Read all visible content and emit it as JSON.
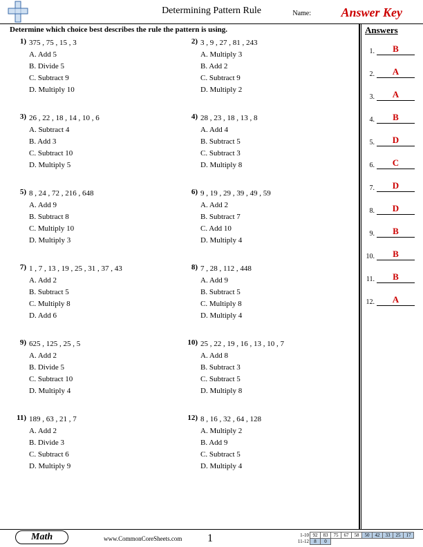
{
  "header": {
    "title": "Determining Pattern Rule",
    "name_label": "Name:",
    "answer_key": "Answer Key"
  },
  "instructions": "Determine which choice best describes the rule the pattern is using.",
  "problems": [
    {
      "n": "1",
      "seq": "375 , 75 , 15 , 3",
      "opts": [
        "A. Add 5",
        "B. Divide 5",
        "C. Subtract 9",
        "D. Multiply 10"
      ]
    },
    {
      "n": "2",
      "seq": "3 , 9 , 27 , 81 , 243",
      "opts": [
        "A. Multiply 3",
        "B. Add 2",
        "C. Subtract 9",
        "D. Multiply 2"
      ]
    },
    {
      "n": "3",
      "seq": "26 , 22 , 18 , 14 , 10 , 6",
      "opts": [
        "A. Subtract 4",
        "B. Add 3",
        "C. Subtract 10",
        "D. Multiply 5"
      ]
    },
    {
      "n": "4",
      "seq": "28 , 23 , 18 , 13 , 8",
      "opts": [
        "A. Add 4",
        "B. Subtract 5",
        "C. Subtract 3",
        "D. Multiply 8"
      ]
    },
    {
      "n": "5",
      "seq": "8 , 24 , 72 , 216 , 648",
      "opts": [
        "A. Add 9",
        "B. Subtract 8",
        "C. Multiply 10",
        "D. Multiply 3"
      ]
    },
    {
      "n": "6",
      "seq": "9 , 19 , 29 , 39 , 49 , 59",
      "opts": [
        "A. Add 2",
        "B. Subtract 7",
        "C. Add 10",
        "D. Multiply 4"
      ]
    },
    {
      "n": "7",
      "seq": "1 , 7 , 13 , 19 , 25 , 31 , 37 , 43",
      "opts": [
        "A. Add 2",
        "B. Subtract 5",
        "C. Multiply 8",
        "D. Add 6"
      ]
    },
    {
      "n": "8",
      "seq": "7 , 28 , 112 , 448",
      "opts": [
        "A. Add 9",
        "B. Subtract 5",
        "C. Multiply 8",
        "D. Multiply 4"
      ]
    },
    {
      "n": "9",
      "seq": "625 , 125 , 25 , 5",
      "opts": [
        "A. Add 2",
        "B. Divide 5",
        "C. Subtract 10",
        "D. Multiply 4"
      ]
    },
    {
      "n": "10",
      "seq": "25 , 22 , 19 , 16 , 13 , 10 , 7",
      "opts": [
        "A. Add 8",
        "B. Subtract 3",
        "C. Subtract 5",
        "D. Multiply 8"
      ]
    },
    {
      "n": "11",
      "seq": "189 , 63 , 21 , 7",
      "opts": [
        "A. Add 2",
        "B. Divide 3",
        "C. Subtract 6",
        "D. Multiply 9"
      ]
    },
    {
      "n": "12",
      "seq": "8 , 16 , 32 , 64 , 128",
      "opts": [
        "A. Multiply 2",
        "B. Add 9",
        "C. Subtract 5",
        "D. Multiply 4"
      ]
    }
  ],
  "answers_header": "Answers",
  "answers": [
    "B",
    "A",
    "A",
    "B",
    "D",
    "C",
    "D",
    "D",
    "B",
    "B",
    "B",
    "A"
  ],
  "footer": {
    "subject": "Math",
    "website": "www.CommonCoreSheets.com",
    "page": "1",
    "score": {
      "row1_label": "1-10",
      "row1": [
        "92",
        "83",
        "75",
        "67",
        "58",
        "50",
        "42",
        "33",
        "25",
        "17"
      ],
      "row2_label": "11-12",
      "row2": [
        "8",
        "0"
      ]
    }
  }
}
